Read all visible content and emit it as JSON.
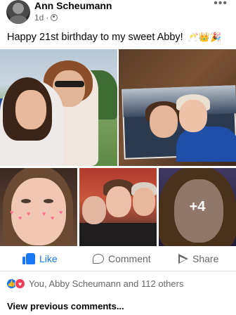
{
  "post": {
    "author": "Ann Scheumann",
    "time": "1d",
    "separator": "·",
    "more_icon": "ellipsis-icon",
    "text": "Happy 21st birthday to my sweet Abby!",
    "emojis": "🥂👑🎉"
  },
  "photos": {
    "more_count": "+4"
  },
  "actions": {
    "like": "Like",
    "comment": "Comment",
    "share": "Share"
  },
  "reactions": {
    "summary": "You, Abby Scheumann and 112 others"
  },
  "comments": {
    "view_previous": "View previous comments..."
  },
  "colors": {
    "accent": "#1877f2",
    "love": "#f33e58",
    "secondary_text": "#65676b"
  }
}
